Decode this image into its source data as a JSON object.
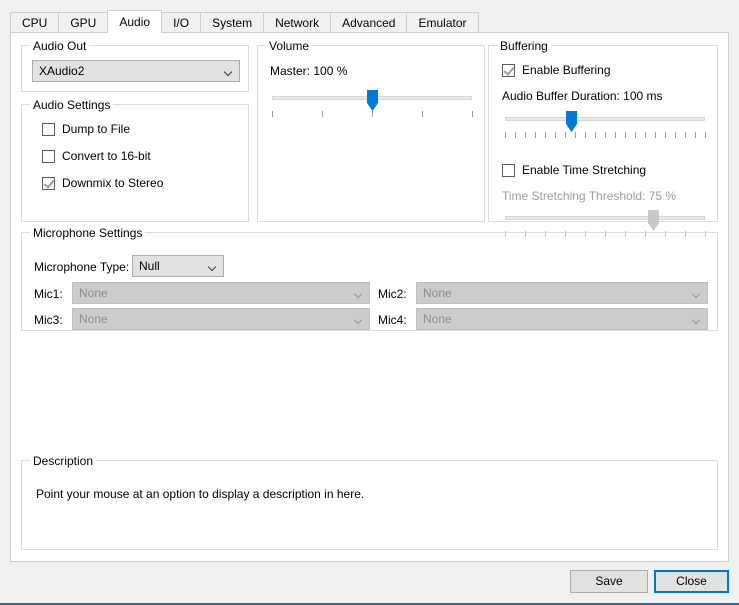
{
  "tabs": [
    {
      "label": "CPU",
      "active": false
    },
    {
      "label": "GPU",
      "active": false
    },
    {
      "label": "Audio",
      "active": true
    },
    {
      "label": "I/O",
      "active": false
    },
    {
      "label": "System",
      "active": false
    },
    {
      "label": "Network",
      "active": false
    },
    {
      "label": "Advanced",
      "active": false
    },
    {
      "label": "Emulator",
      "active": false
    }
  ],
  "audio_out": {
    "title": "Audio Out",
    "backend_value": "XAudio2"
  },
  "audio_settings": {
    "title": "Audio Settings",
    "options": [
      {
        "label": "Dump to File",
        "checked": false
      },
      {
        "label": "Convert to 16-bit",
        "checked": false
      },
      {
        "label": "Downmix to Stereo",
        "checked": true
      }
    ]
  },
  "volume": {
    "title": "Volume",
    "master_label": "Master: 100 %",
    "master_percent": 50,
    "tick_count": 5
  },
  "buffering": {
    "title": "Buffering",
    "enable_buffering": {
      "label": "Enable Buffering",
      "checked": true
    },
    "buffer_duration_label": "Audio Buffer Duration: 100 ms",
    "buffer_duration_percent": 33,
    "buffer_tick_count": 21,
    "enable_time_stretching": {
      "label": "Enable Time Stretching",
      "checked": false
    },
    "time_stretch_label": "Time Stretching Threshold: 75 %",
    "time_stretch_percent": 74,
    "time_stretch_tick_count": 11
  },
  "microphone": {
    "title": "Microphone Settings",
    "type_label": "Microphone Type:",
    "type_value": "Null",
    "mics": [
      {
        "label": "Mic1:",
        "value": "None"
      },
      {
        "label": "Mic2:",
        "value": "None"
      },
      {
        "label": "Mic3:",
        "value": "None"
      },
      {
        "label": "Mic4:",
        "value": "None"
      }
    ]
  },
  "description": {
    "title": "Description",
    "text": "Point your mouse at an option to display a description in here."
  },
  "footer": {
    "save_label": "Save",
    "close_label": "Close"
  },
  "colors": {
    "accent": "#0078d7",
    "window_bg": "#f0f0f0",
    "page_bg": "#ffffff"
  }
}
